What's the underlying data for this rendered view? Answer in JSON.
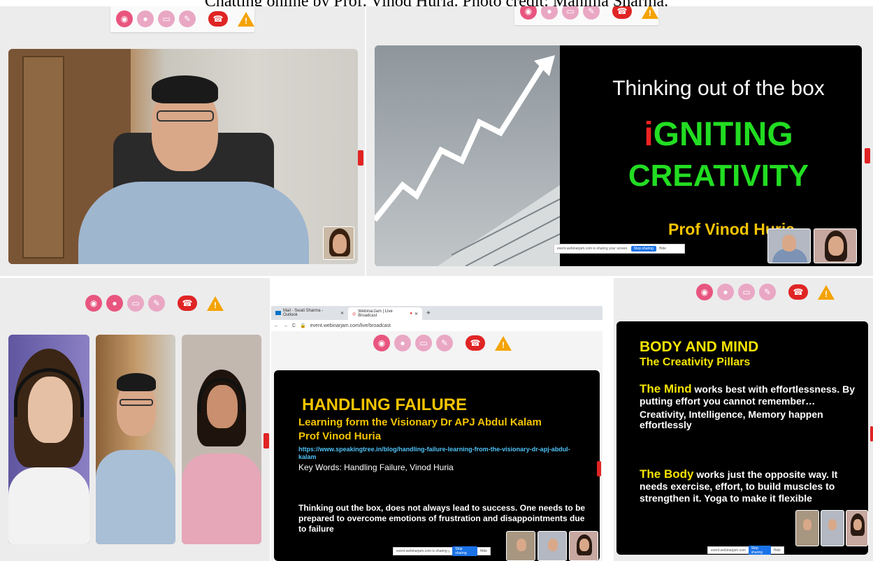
{
  "top_caption": "Chatting online by Prof. Vinod Huria. Photo credit: Mahima Sharma.",
  "toolbar_icons": [
    "participants-icon",
    "microphone-icon",
    "screen-share-icon",
    "pen-icon",
    "end-call-icon",
    "warning-icon"
  ],
  "slide1": {
    "line1": "Thinking out of the box",
    "line2_first": "i",
    "line2_rest": "GNITING",
    "line3": "CREATIVITY",
    "author": "Prof Vinod Huria",
    "colors": {
      "accent_green": "#22dd22",
      "accent_red": "#ee2222",
      "author_yellow": "#f5c400"
    }
  },
  "browser": {
    "tab1": "Mail - Swati Sharma - Outlook",
    "tab2": "WebinarJam | Live Broadcast",
    "url": "event.webinarjam.com/live/broadcast"
  },
  "slide2": {
    "title": "HANDLING FAILURE",
    "subtitle": "Learning form the Visionary Dr APJ Abdul Kalam",
    "author": "Prof Vinod Huria",
    "link": "https://www.speakingtree.in/blog/handling-failure-learning-from-the-visionary-dr-apj-abdul-kalam",
    "keywords": "Key Words: Handling Failure, Vinod Huria",
    "body": "Thinking out the box, does not always lead to success. One needs to be prepared to overcome emotions of frustration and disappointments due to failure"
  },
  "slide3": {
    "title": "BODY AND MIND",
    "subtitle": "The Creativity Pillars",
    "mind_label": "The Mind",
    "mind_text": " works best with effortlessness. By putting effort you cannot remember…",
    "mind_text2": "Creativity, Intelligence, Memory happen effortlessly",
    "body_label": "The Body",
    "body_text": " works just the opposite way. It needs exercise, effort, to build muscles to strengthen it. Yoga to make it flexible"
  },
  "sharebar": {
    "text": "event.webinarjam.com is sharing your screen.",
    "stop": "Stop sharing",
    "hide": "Hide"
  }
}
